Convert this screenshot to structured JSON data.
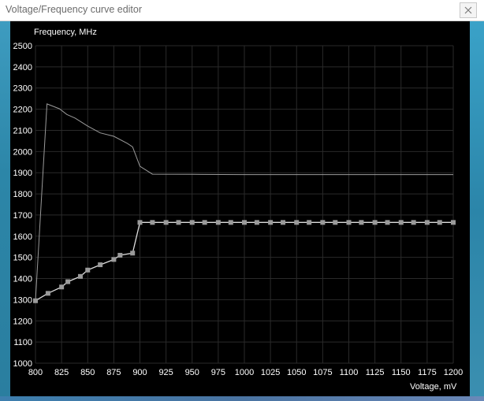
{
  "window": {
    "title": "Voltage/Frequency curve editor"
  },
  "colors": {
    "background": "#000000",
    "grid": "#2a2a2a",
    "axis_text": "#ffffff",
    "editable_curve": "#dcdcdc",
    "reference_curve": "#9a9a9a",
    "point_marker": "#9a9a9a"
  },
  "chart_data": {
    "type": "line",
    "title": "",
    "xlabel": "Voltage, mV",
    "ylabel": "Frequency, MHz",
    "xlim": [
      800,
      1200
    ],
    "ylim": [
      1000,
      2500
    ],
    "grid": true,
    "x_ticks": [
      "800",
      "825",
      "850",
      "875",
      "900",
      "925",
      "950",
      "975",
      "1000",
      "1025",
      "1050",
      "1075",
      "1100",
      "1125",
      "1150",
      "1175",
      "1200"
    ],
    "y_ticks": [
      "2500",
      "2400",
      "2300",
      "2200",
      "2100",
      "2000",
      "1900",
      "1800",
      "1700",
      "1600",
      "1500",
      "1400",
      "1300",
      "1200",
      "1100",
      "1000"
    ],
    "series": [
      {
        "role": "reference",
        "points": [
          [
            800,
            1295
          ],
          [
            811,
            2225
          ],
          [
            823,
            2202
          ],
          [
            830,
            2175
          ],
          [
            838,
            2158
          ],
          [
            850,
            2120
          ],
          [
            862,
            2088
          ],
          [
            875,
            2072
          ],
          [
            888,
            2038
          ],
          [
            893,
            2022
          ],
          [
            900,
            1930
          ],
          [
            912,
            1893
          ],
          [
            950,
            1892
          ],
          [
            1000,
            1891
          ],
          [
            1100,
            1891
          ],
          [
            1200,
            1891
          ]
        ]
      },
      {
        "role": "editable",
        "markers": true,
        "points": [
          [
            800,
            1295
          ],
          [
            812,
            1330
          ],
          [
            825,
            1360
          ],
          [
            831,
            1385
          ],
          [
            843,
            1410
          ],
          [
            850,
            1440
          ],
          [
            862,
            1465
          ],
          [
            875,
            1490
          ],
          [
            881,
            1510
          ],
          [
            893,
            1520
          ],
          [
            900,
            1665
          ],
          [
            912,
            1665
          ],
          [
            925,
            1665
          ],
          [
            937,
            1665
          ],
          [
            950,
            1665
          ],
          [
            962,
            1665
          ],
          [
            975,
            1665
          ],
          [
            987,
            1665
          ],
          [
            1000,
            1665
          ],
          [
            1012,
            1665
          ],
          [
            1025,
            1665
          ],
          [
            1037,
            1665
          ],
          [
            1050,
            1665
          ],
          [
            1062,
            1665
          ],
          [
            1075,
            1665
          ],
          [
            1087,
            1665
          ],
          [
            1100,
            1665
          ],
          [
            1112,
            1665
          ],
          [
            1125,
            1665
          ],
          [
            1137,
            1665
          ],
          [
            1150,
            1665
          ],
          [
            1162,
            1665
          ],
          [
            1175,
            1665
          ],
          [
            1187,
            1665
          ],
          [
            1200,
            1665
          ]
        ]
      }
    ]
  }
}
